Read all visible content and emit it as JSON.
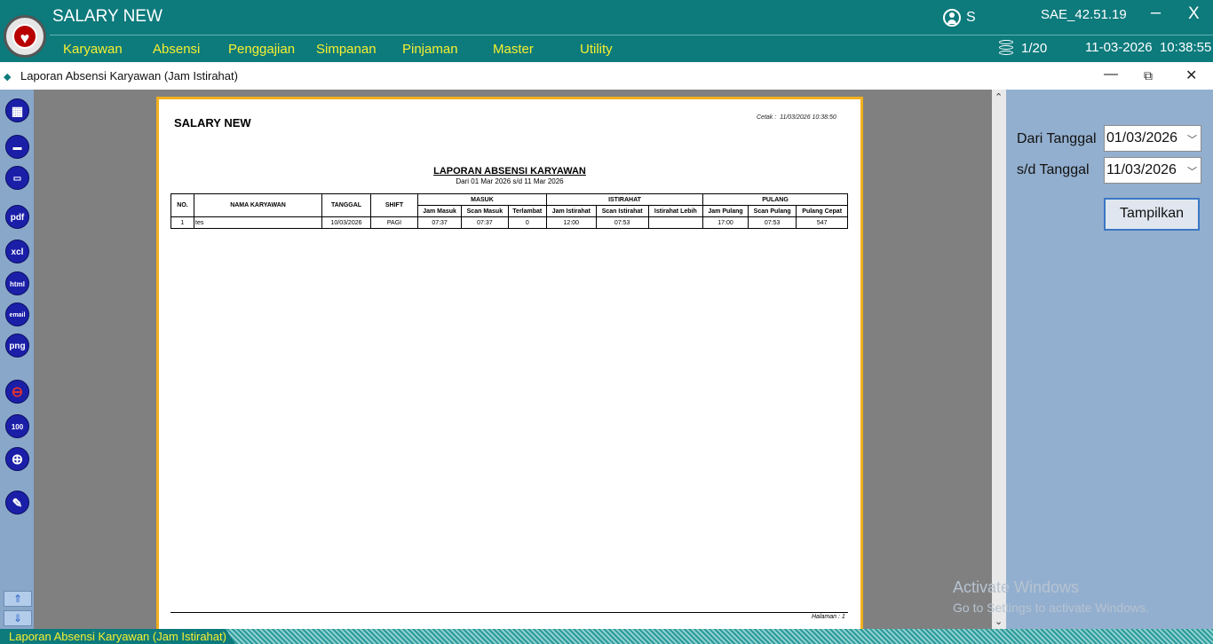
{
  "app": {
    "title": "SALARY NEW",
    "user_initial": "S",
    "version": "SAE_42.51.19",
    "min_label": "–",
    "close_label": "X",
    "db_count": "1/20",
    "date": "11-03-2026",
    "time": "10:38:55",
    "accent": "#0d7a7c",
    "menu_color": "#f7f030"
  },
  "menu": [
    "Karyawan",
    "Absensi",
    "Penggajian",
    "Simpanan",
    "Pinjaman",
    "Master",
    "Utility"
  ],
  "window": {
    "title": "Laporan Absensi Karyawan (Jam Istirahat)",
    "minimize": "—",
    "restore": "⧉",
    "close": "✕"
  },
  "tools": [
    {
      "icon": "grid-icon",
      "label": "▦"
    },
    {
      "icon": "print-icon",
      "label": "▬"
    },
    {
      "icon": "monitor-icon",
      "label": "▭"
    },
    {
      "icon": "pdf-icon",
      "label": "pdf"
    },
    {
      "icon": "xcl-icon",
      "label": "xcl"
    },
    {
      "icon": "html-icon",
      "label": "html"
    },
    {
      "icon": "email-icon",
      "label": "email"
    },
    {
      "icon": "png-icon",
      "label": "png"
    },
    {
      "icon": "zoom-out-icon",
      "label": "⊖"
    },
    {
      "icon": "zoom-100-icon",
      "label": "100"
    },
    {
      "icon": "zoom-in-icon",
      "label": "⊕"
    },
    {
      "icon": "edit-icon",
      "label": "✎"
    }
  ],
  "report": {
    "app_name": "SALARY NEW",
    "print_label": "Cetak :",
    "print_time": "11/03/2026 10:38:50",
    "title": "LAPORAN ABSENSI KARYAWAN",
    "range": "Dari   01 Mar 2026  s/d  11 Mar 2026",
    "groups": [
      "MASUK",
      "ISTIRAHAT",
      "PULANG"
    ],
    "main_headers": [
      "NO.",
      "NAMA KARYAWAN",
      "TANGGAL",
      "SHIFT"
    ],
    "sub_headers": [
      "Jam Masuk",
      "Scan Masuk",
      "Terlambat",
      "Jam Istirahat",
      "Scan Istirahat",
      "Istirahat Lebih",
      "Jam Pulang",
      "Scan Pulang",
      "Pulang Cepat"
    ],
    "rows": [
      [
        "1",
        "tes",
        "10/03/2026",
        "PAGI",
        "07:37",
        "07:37",
        "0",
        "12:00",
        "07:53",
        "",
        "17:00",
        "07:53",
        "547"
      ]
    ],
    "footer": "Halaman : 1"
  },
  "filter": {
    "from_label": "Dari Tanggal",
    "from_value": "01/03/2026",
    "to_label": "s/d Tanggal",
    "to_value": "11/03/2026",
    "button": "Tampilkan"
  },
  "watermark": {
    "line1": "Activate Windows",
    "line2": "Go to Settings to activate Windows."
  },
  "status_tab": "Laporan Absensi Karyawan (Jam Istirahat)"
}
